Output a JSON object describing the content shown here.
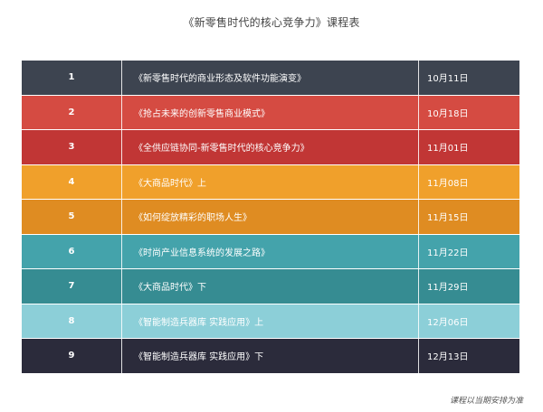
{
  "title": "《新零售时代的核心竞争力》课程表",
  "rows": [
    {
      "num": "1",
      "course": "《新零售时代的商业形态及软件功能演变》",
      "date": "10月11日",
      "color": "#3d4450"
    },
    {
      "num": "2",
      "course": "《抢占未来的创新零售商业模式》",
      "date": "10月18日",
      "color": "#d54b42"
    },
    {
      "num": "3",
      "course": "《全供应链协同-新零售时代的核心竞争力》",
      "date": "11月01日",
      "color": "#c13635"
    },
    {
      "num": "4",
      "course": "《大商品时代》上",
      "date": "11月08日",
      "color": "#f0a02b"
    },
    {
      "num": "5",
      "course": "《如何绽放精彩的职场人生》",
      "date": "11月15日",
      "color": "#df8c22"
    },
    {
      "num": "6",
      "course": "《时尚产业信息系统的发展之路》",
      "date": "11月22日",
      "color": "#44a3ab"
    },
    {
      "num": "7",
      "course": "《大商品时代》下",
      "date": "11月29日",
      "color": "#368c92"
    },
    {
      "num": "8",
      "course": "《智能制造兵器库 实践应用》上",
      "date": "12月06日",
      "color": "#8ccfd8"
    },
    {
      "num": "9",
      "course": "《智能制造兵器库 实践应用》下",
      "date": "12月13日",
      "color": "#2b2b3b"
    }
  ],
  "footnote": "课程以当期安排为准"
}
